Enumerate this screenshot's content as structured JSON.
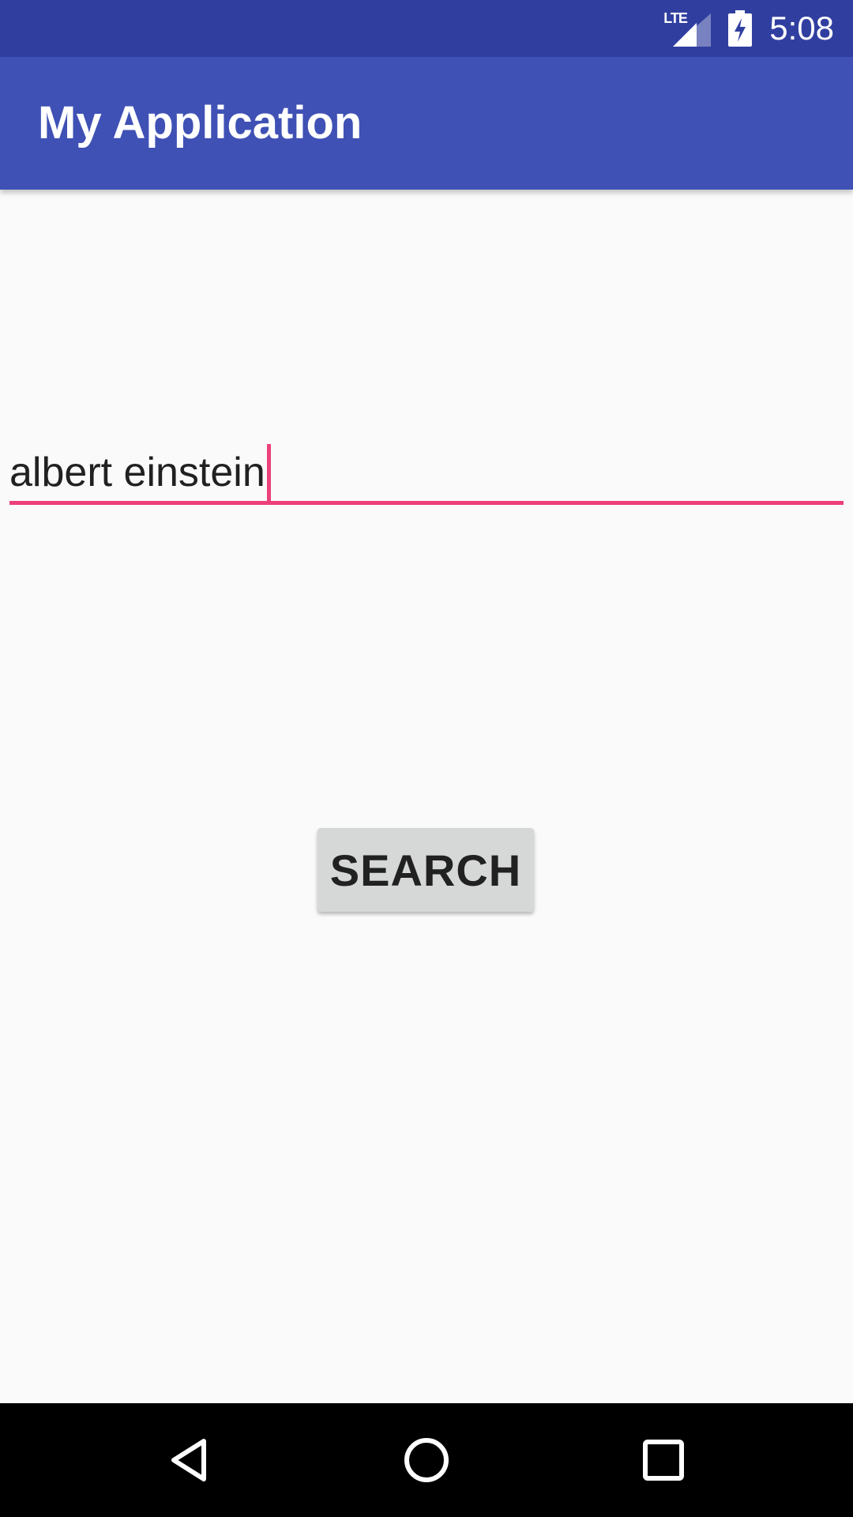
{
  "status_bar": {
    "network_label": "LTE",
    "time": "5:08",
    "icons": [
      "lte-signal-icon",
      "battery-charging-icon"
    ]
  },
  "app_bar": {
    "title": "My Application"
  },
  "search": {
    "value": "albert einstein",
    "button_label": "SEARCH"
  },
  "nav_bar": {
    "icons": [
      "back-icon",
      "home-icon",
      "recents-icon"
    ]
  },
  "colors": {
    "status_bar": "#303f9f",
    "app_bar": "#3f51b5",
    "accent": "#ec407a",
    "background": "#fafafa",
    "button": "#d6d7d7"
  }
}
